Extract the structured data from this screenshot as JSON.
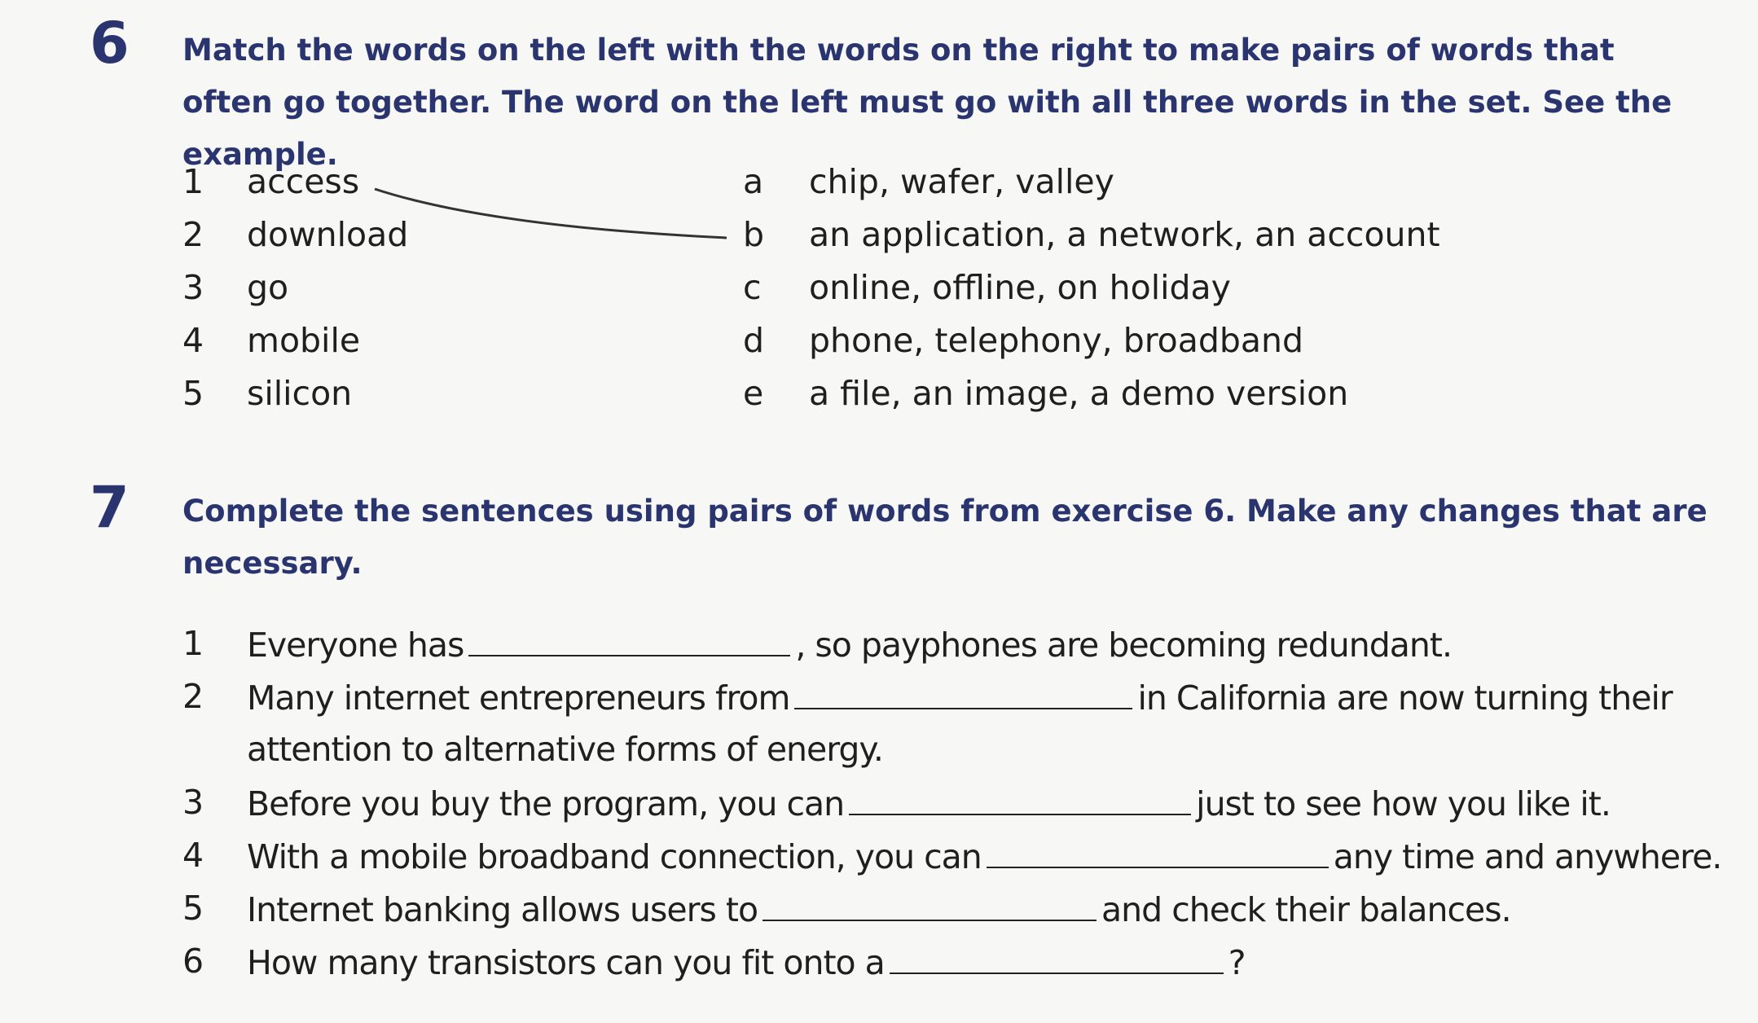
{
  "exercise6": {
    "number": "6",
    "instruction": "Match the words on the left with the words on the right to make pairs of words that often go together. The word on the left must go with all three words in the set. See the example.",
    "left": [
      {
        "num": "1",
        "word": "access"
      },
      {
        "num": "2",
        "word": "download"
      },
      {
        "num": "3",
        "word": "go"
      },
      {
        "num": "4",
        "word": "mobile"
      },
      {
        "num": "5",
        "word": "silicon"
      }
    ],
    "right": [
      {
        "letter": "a",
        "set": "chip, wafer, valley"
      },
      {
        "letter": "b",
        "set": "an application, a network, an account"
      },
      {
        "letter": "c",
        "set": "online, offline, on holiday"
      },
      {
        "letter": "d",
        "set": "phone, telephony, broadband"
      },
      {
        "letter": "e",
        "set": "a file, an image, a demo version"
      }
    ]
  },
  "exercise7": {
    "number": "7",
    "instruction": "Complete the sentences using pairs of words from exercise 6. Make any changes that are necessary.",
    "sentences": [
      {
        "num": "1",
        "before": "Everyone has",
        "after": ", so payphones are becoming redundant."
      },
      {
        "num": "2",
        "before": "Many internet entrepreneurs from",
        "after": "in California are now turning their",
        "continuation": "attention to alternative forms of energy."
      },
      {
        "num": "3",
        "before": "Before you buy the program, you can",
        "after": "just to see how you like it."
      },
      {
        "num": "4",
        "before": "With a mobile broadband connection, you can",
        "after": "any time and anywhere."
      },
      {
        "num": "5",
        "before": "Internet banking allows users to",
        "after": "and check their balances."
      },
      {
        "num": "6",
        "before": "How many transistors can you fit onto a",
        "after": "?"
      }
    ]
  }
}
